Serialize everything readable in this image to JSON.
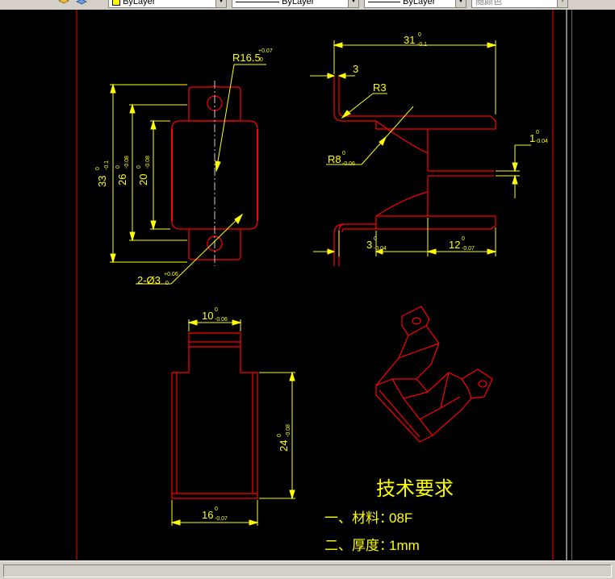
{
  "toolbar": {
    "color_combo": "ByLayer",
    "linetype_combo": "ByLayer",
    "lineweight_combo": "ByLayer",
    "plotstyle_combo": "随颜色"
  },
  "drawing": {
    "colors": {
      "geometry": "#ff0000",
      "dimension": "#ffff00",
      "border": "#ff0000",
      "text": "#ffff00"
    },
    "dims": {
      "r16_5": "R16.5",
      "r16_5_tol_up": "+0.07",
      "r16_5_tol_dn": "0",
      "d33": "33",
      "d33_up": "0",
      "d33_dn": "-0.1",
      "d26": "26",
      "d26_up": "0",
      "d26_dn": "-0.08",
      "d20": "20",
      "d20_up": "0",
      "d20_dn": "-0.08",
      "holes": "2-Ø3",
      "holes_up": "+0.06",
      "holes_dn": "0",
      "d31": "31",
      "d31_up": "0",
      "d31_dn": "-0.1",
      "d3_top": "3",
      "r3": "R3",
      "r8": "R8",
      "r8_up": "0",
      "r8_dn": "-0.06",
      "d1": "1",
      "d1_up": "0",
      "d1_dn": "-0.04",
      "d3_bot": "3",
      "d3_bot_up": "0",
      "d3_bot_dn": "-0.04",
      "d12": "12",
      "d12_up": "0",
      "d12_dn": "-0.07",
      "d10": "10",
      "d10_up": "0",
      "d10_dn": "-0.06",
      "d24": "24",
      "d24_up": "0",
      "d24_dn": "-0.08",
      "d16": "16",
      "d16_up": "0",
      "d16_dn": "-0.07"
    },
    "notes": {
      "title": "技术要求",
      "line1_label": "一、材料：",
      "line1_value": "08F",
      "line2_label": "二、厚度：",
      "line2_value": "1mm"
    }
  }
}
